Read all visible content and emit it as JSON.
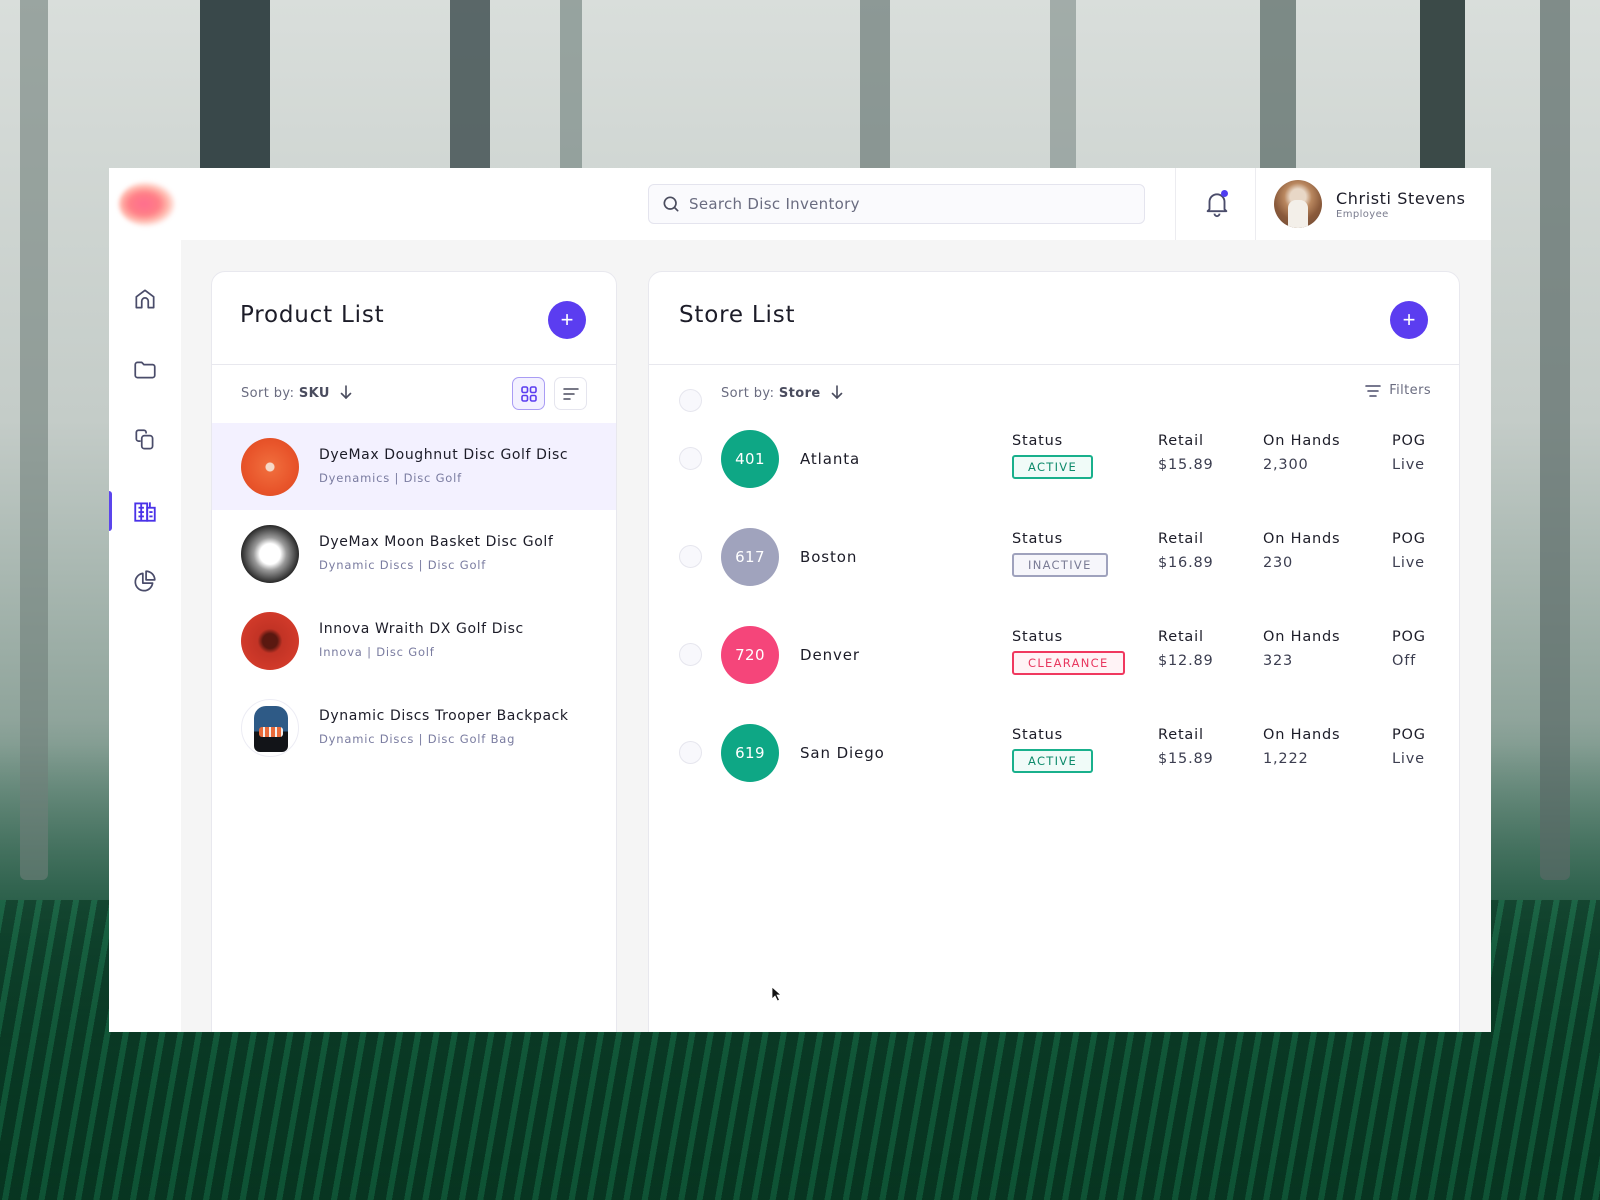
{
  "search": {
    "placeholder": "Search Disc Inventory"
  },
  "user": {
    "name": "Christi Stevens",
    "role": "Employee"
  },
  "sidebar": {
    "items": [
      {
        "icon": "home-icon",
        "label": "Home",
        "active": false
      },
      {
        "icon": "folder-icon",
        "label": "Folders",
        "active": false
      },
      {
        "icon": "copy-icon",
        "label": "Copies",
        "active": false
      },
      {
        "icon": "building-icon",
        "label": "Stores",
        "active": true
      },
      {
        "icon": "pie-chart-icon",
        "label": "Reports",
        "active": false
      }
    ]
  },
  "product_list": {
    "title": "Product List",
    "add_label": "+",
    "sort_prefix": "Sort by:",
    "sort_field": "SKU",
    "items": [
      {
        "name": "DyeMax Doughnut Disc Golf Disc",
        "meta": "Dyenamics  |  Disc Golf",
        "selected": true,
        "thumb": "orange-disc"
      },
      {
        "name": "DyeMax Moon Basket Disc Golf",
        "meta": "Dynamic Discs | Disc Golf",
        "selected": false,
        "thumb": "moon-disc"
      },
      {
        "name": "Innova Wraith DX Golf Disc",
        "meta": "Innova  |  Disc Golf",
        "selected": false,
        "thumb": "red-disc"
      },
      {
        "name": "Dynamic Discs Trooper Backpack",
        "meta": "Dynamic Discs  |  Disc Golf Bag",
        "selected": false,
        "thumb": "backpack"
      }
    ]
  },
  "store_list": {
    "title": "Store List",
    "add_label": "+",
    "sort_prefix": "Sort by:",
    "sort_field": "Store",
    "filters_label": "Filters",
    "columns": {
      "status": "Status",
      "retail": "Retail",
      "on_hands": "On Hands",
      "pog": "POG"
    },
    "rows": [
      {
        "code": "401",
        "name": "Atlanta",
        "status": "ACTIVE",
        "retail": "$15.89",
        "on_hands": "2,300",
        "pog": "Live",
        "badge_color": "#0ea785"
      },
      {
        "code": "617",
        "name": "Boston",
        "status": "INACTIVE",
        "retail": "$16.89",
        "on_hands": "230",
        "pog": "Live",
        "badge_color": "#a0a3bd"
      },
      {
        "code": "720",
        "name": "Denver",
        "status": "CLEARANCE",
        "retail": "$12.89",
        "on_hands": "323",
        "pog": "Off",
        "badge_color": "#f5457a"
      },
      {
        "code": "619",
        "name": "San Diego",
        "status": "ACTIVE",
        "retail": "$15.89",
        "on_hands": "1,222",
        "pog": "Live",
        "badge_color": "#0ea785"
      }
    ]
  },
  "status_colors": {
    "ACTIVE": {
      "text": "#0d8a6b",
      "border": "#19b08c",
      "bg": "#f0fbf8"
    },
    "INACTIVE": {
      "text": "#7a7c95",
      "border": "#9fa2bd",
      "bg": "#f6f6fb"
    },
    "CLEARANCE": {
      "text": "#e8375f",
      "border": "#f0385f",
      "bg": "#fff3f6"
    }
  },
  "accent_color": "#5b3df0"
}
